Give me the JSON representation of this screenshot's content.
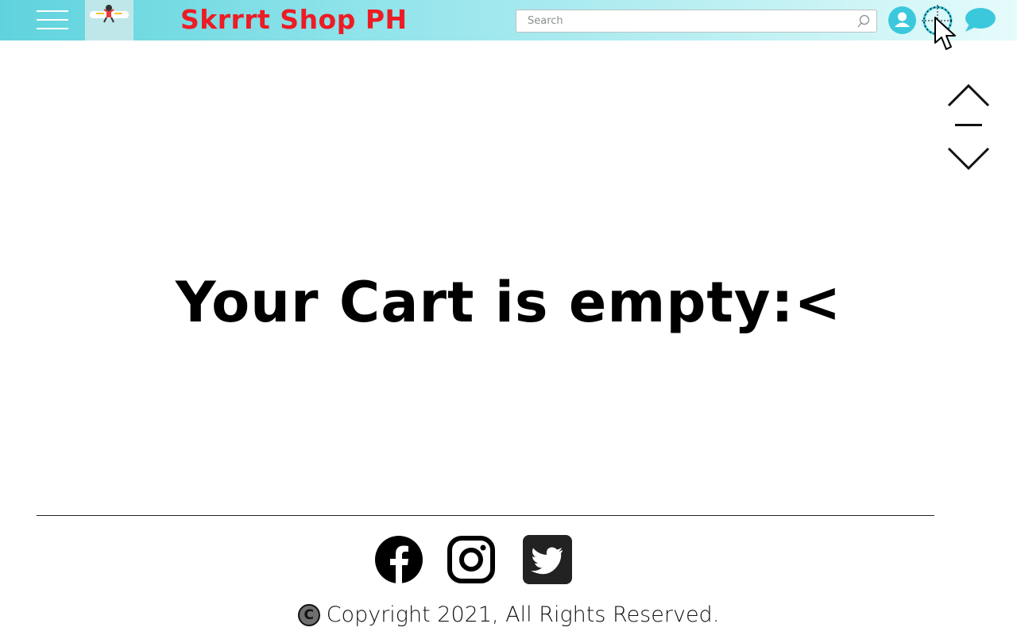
{
  "header": {
    "brand_title": "Skrrrt Shop PH",
    "search_placeholder": "Search",
    "icons": [
      "menu-icon",
      "logo",
      "search-icon",
      "user-icon",
      "cart-icon",
      "chat-icon"
    ]
  },
  "main": {
    "empty_message": "Your Cart is empty:<"
  },
  "scroll": {
    "up_icon": "chevron-up-icon",
    "down_icon": "chevron-down-icon"
  },
  "footer": {
    "social": [
      "facebook-icon",
      "instagram-icon",
      "twitter-icon"
    ],
    "copyright_symbol": "C",
    "copyright_text": "Copyright 2021, All Rights Reserved."
  },
  "colors": {
    "header_gradient_start": "#5fd3dd",
    "header_gradient_end": "#e6fbfb",
    "brand": "#ed1c24",
    "accent": "#3cc8dc"
  }
}
